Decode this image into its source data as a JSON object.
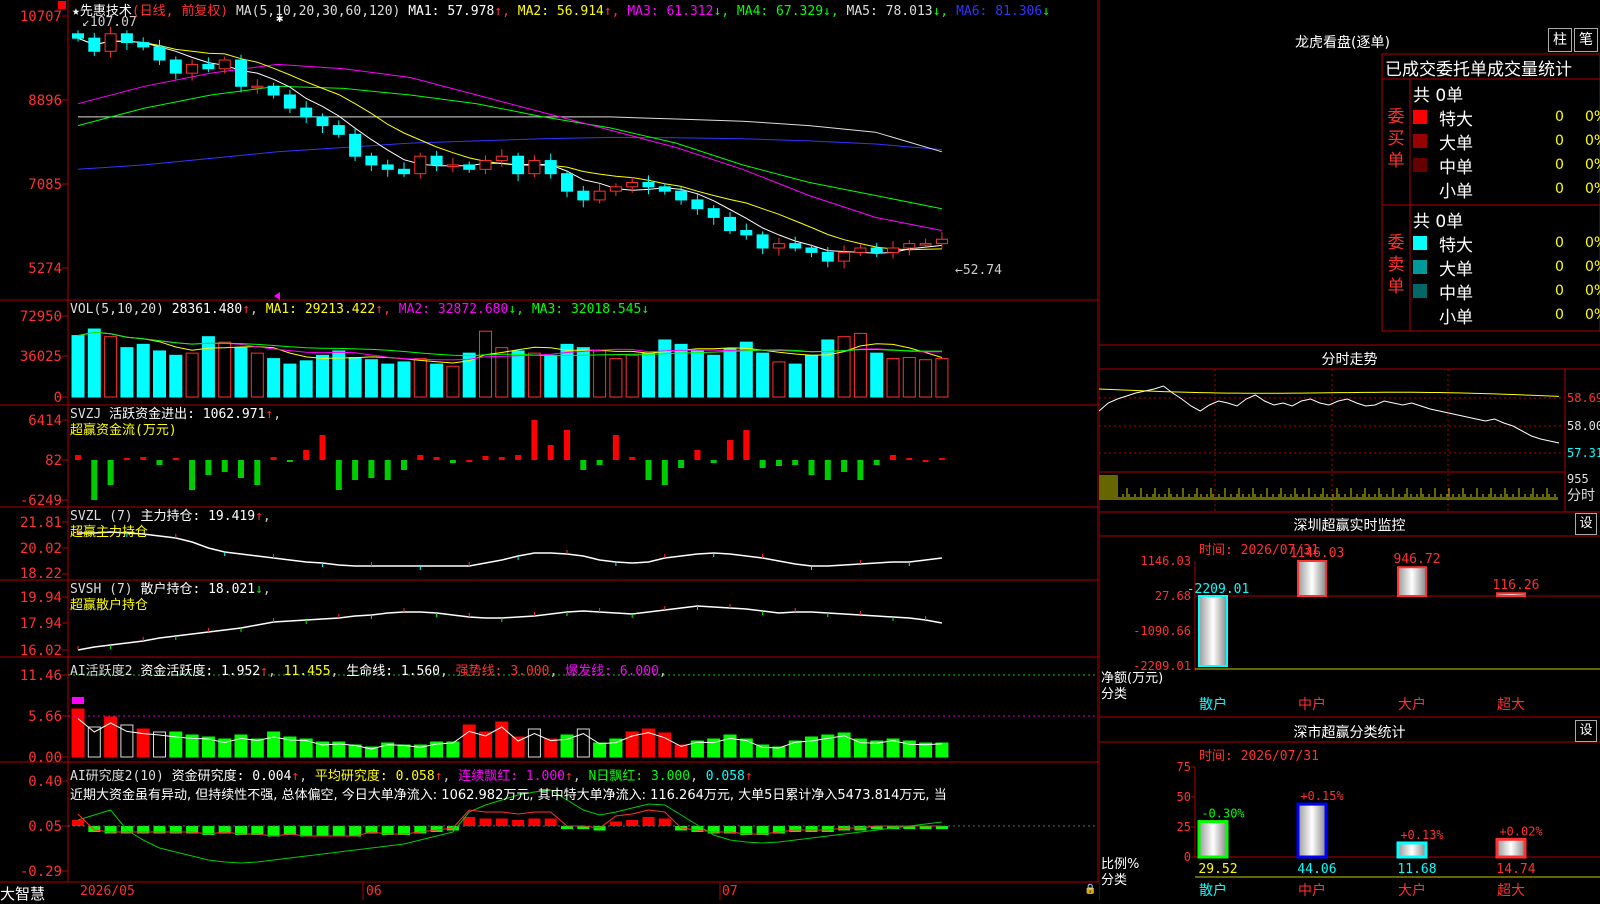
{
  "stock": {
    "star": "★",
    "name": "先惠技术",
    "period": "(日线, 前复权)",
    "ma_label": "MA(5,10,20,30,60,120)",
    "ma": [
      {
        "label": "MA1:",
        "value": "57.978",
        "arrow": "↑",
        "color": "#ffffff"
      },
      {
        "label": "MA2:",
        "value": "56.914",
        "arrow": "↑",
        "color": "#ffff00"
      },
      {
        "label": "MA3:",
        "value": "61.312",
        "arrow": "↓",
        "color": "#ff00ff"
      },
      {
        "label": "MA4:",
        "value": "67.329",
        "arrow": "↓",
        "color": "#00ff00"
      },
      {
        "label": "MA5:",
        "value": "78.013",
        "arrow": "↓",
        "color": "#dddddd"
      },
      {
        "label": "MA6:",
        "value": "81.306",
        "arrow": "↓",
        "color": "#3333ff"
      }
    ],
    "high_mark": "107.07",
    "low_mark": "52.74",
    "price_axis": [
      "10707",
      "8896",
      "7085",
      "5274"
    ]
  },
  "vol": {
    "label": "VOL(5,10,20)",
    "value": "28361.480",
    "arrow": "↑",
    "ma": [
      {
        "label": "MA1:",
        "value": "29213.422",
        "arrow": "↑",
        "color": "#ffff00"
      },
      {
        "label": "MA2:",
        "value": "32872.680",
        "arrow": "↓",
        "color": "#ff00ff"
      },
      {
        "label": "MA3:",
        "value": "32018.545",
        "arrow": "↓",
        "color": "#00ff00"
      }
    ],
    "axis": [
      "72950",
      "36025",
      "0"
    ]
  },
  "svzj": {
    "label": "SVZJ",
    "series": "活跃资金进出:",
    "value": "1062.971",
    "arrow": "↑",
    "subtitle": "超赢资金流(万元)",
    "axis": [
      "6414",
      "82",
      "-6249"
    ]
  },
  "svzl": {
    "label": "SVZL (7)",
    "series": "主力持仓:",
    "value": "19.419",
    "arrow": "↑",
    "subtitle": "超赢主力持仓",
    "axis": [
      "21.81",
      "20.02",
      "18.22"
    ]
  },
  "svsh": {
    "label": "SVSH (7)",
    "series": "散户持仓:",
    "value": "18.021",
    "arrow": "↓",
    "subtitle": "超赢散户持仓",
    "axis": [
      "19.94",
      "17.94",
      "16.02"
    ]
  },
  "ai_act": {
    "label": "AI活跃度2",
    "s1": "资金活跃度:",
    "v1": "1.952",
    "v2": "11.455",
    "s3": "生命线:",
    "v3": "1.560",
    "s4": "强势线:",
    "v4": "3.000",
    "s5": "爆发线:",
    "v5": "6.000",
    "axis": [
      "11.46",
      "5.66",
      "0.00"
    ]
  },
  "ai_res": {
    "label": "AI研究度2(10)",
    "s1": "资金研究度:",
    "v1": "0.004",
    "s2": "平均研究度:",
    "v2": "0.058",
    "s3": "连续飘红:",
    "v3": "1.000",
    "s4": "N日飘红:",
    "v4": "3.000",
    "v5": "0.058",
    "comment": "近期大资金虽有异动, 但持续性不强, 总体偏空, 今日大单净流入: 1062.982万元, 其中特大单净流入: 116.264万元, 大单5日累计净入5473.814万元, 当",
    "axis": [
      "0.40",
      "0.05",
      "-0.29"
    ]
  },
  "dates": [
    "2026/05",
    "06",
    "07"
  ],
  "brand": "大智慧",
  "right": {
    "lhb_title": "龙虎看盘(逐单)",
    "btn_zhu": "柱",
    "btn_bi": "笔",
    "tabs": "已成交委托单成交量统计",
    "buy": {
      "side_label": "委买单",
      "total": "共 0单",
      "rows": [
        {
          "name": "特大",
          "count": "0",
          "pct": "0%",
          "color": "#ff0000"
        },
        {
          "name": "大单",
          "count": "0",
          "pct": "0%",
          "color": "#990000"
        },
        {
          "name": "中单",
          "count": "0",
          "pct": "0%",
          "color": "#660000"
        },
        {
          "name": "小单",
          "count": "0",
          "pct": "0%",
          "color": "#000000"
        }
      ]
    },
    "sell": {
      "side_label": "委卖单",
      "total": "共 0单",
      "rows": [
        {
          "name": "特大",
          "count": "0",
          "pct": "0%",
          "color": "#00ffff"
        },
        {
          "name": "大单",
          "count": "0",
          "pct": "0%",
          "color": "#009999"
        },
        {
          "name": "中单",
          "count": "0",
          "pct": "0%",
          "color": "#006666"
        },
        {
          "name": "小单",
          "count": "0",
          "pct": "0%",
          "color": "#000000"
        }
      ]
    },
    "intraday": {
      "title": "分时走势",
      "axis": [
        "58.69",
        "58.00",
        "57.31"
      ],
      "vol_axis": "955",
      "vol_label": "分时"
    },
    "monitor": {
      "title": "深圳超赢实时监控",
      "btn": "设",
      "time_label": "时间:",
      "time": "2026/07/31",
      "axis": [
        "1146.03",
        "27.68",
        "-1090.66",
        "-2209.01"
      ],
      "axis_label_1": "净额(万元)",
      "axis_label_2": "分类",
      "categories": [
        "散户",
        "中户",
        "大户",
        "超大"
      ],
      "values": [
        -2209.01,
        1146.03,
        946.72,
        116.26
      ],
      "value_labels": [
        "-2209.01",
        "1146.03",
        "946.72",
        "116.26"
      ]
    },
    "classify": {
      "title": "深市超赢分类统计",
      "btn": "设",
      "time_label": "时间:",
      "time": "2026/07/31",
      "axis": [
        "75",
        "50",
        "25",
        "0"
      ],
      "axis_label_1": "比例%",
      "axis_label_2": "分类",
      "categories": [
        "散户",
        "中户",
        "大户",
        "超大"
      ],
      "values": [
        29.52,
        44.06,
        11.68,
        14.74
      ],
      "changes": [
        "-0.30%",
        "+0.15%",
        "+0.13%",
        "+0.02%"
      ]
    }
  },
  "chart_data": {
    "type": "candlestick",
    "title": "先惠技术 (日线, 前复权)",
    "x_labels": [
      "2026/05",
      "06",
      "07"
    ],
    "ylim": [
      52.74,
      107.07
    ],
    "close_approx": [
      104,
      101,
      105,
      103,
      102,
      99,
      96,
      98,
      97,
      99,
      93,
      93,
      91,
      88,
      86,
      84,
      82,
      77,
      75,
      74,
      73,
      77,
      75,
      75,
      74,
      76,
      77,
      73,
      76,
      73,
      69,
      67,
      69,
      70,
      71,
      70,
      69,
      67,
      65,
      63,
      60,
      59,
      56,
      57,
      56,
      55,
      53,
      55,
      56,
      55,
      56,
      57,
      57,
      58
    ]
  }
}
